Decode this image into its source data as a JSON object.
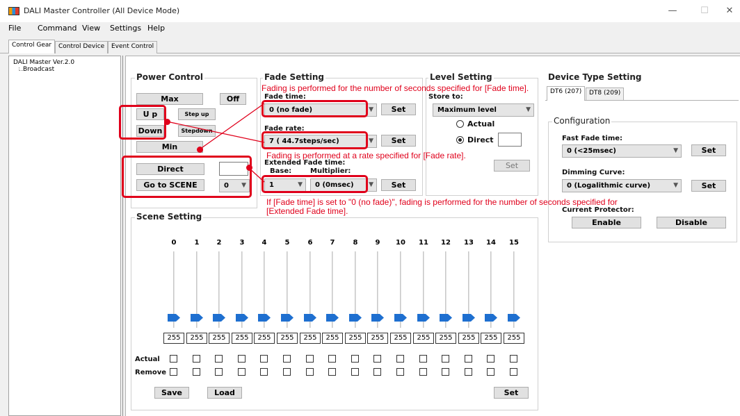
{
  "window": {
    "title": "DALI Master Controller (All Device Mode)",
    "minimize": "—",
    "maximize": "☐",
    "close": "✕"
  },
  "menu": [
    "File",
    "Command",
    "View",
    "Settings",
    "Help"
  ],
  "tabs": [
    "Control Gear",
    "Control Device",
    "Event Control"
  ],
  "tree": {
    "root": "DALI Master Ver.2.0",
    "child": "Broadcast"
  },
  "power_control": {
    "title": "Power Control",
    "max": "Max",
    "off": "Off",
    "up": "U p",
    "step_up": "Step up",
    "down": "Down",
    "step_down": "Stepdown",
    "min": "Min",
    "direct": "Direct",
    "direct_value": "",
    "go_to_scene": "Go to SCENE",
    "scene_value": "0"
  },
  "fade_setting": {
    "title": "Fade Setting",
    "fade_time_label": "Fade time:",
    "fade_time_value": "0 (no fade)",
    "fade_rate_label": "Fade rate:",
    "fade_rate_value": "7 ( 44.7steps/sec)",
    "ext_label": "Extended Fade time:",
    "base_label": "Base:",
    "multiplier_label": "Multiplier:",
    "base_value": "1",
    "multiplier_value": "0 (0msec)",
    "set": "Set"
  },
  "level_setting": {
    "title": "Level Setting",
    "store_label": "Store to:",
    "store_value": "Maximum level",
    "actual": "Actual",
    "direct": "Direct",
    "direct_value": "",
    "set": "Set"
  },
  "device_type": {
    "title": "Device Type Setting",
    "tab_dt6": "DT6 (207)",
    "tab_dt8": "DT8 (209)",
    "configuration": "Configuration",
    "fast_fade_label": "Fast Fade time:",
    "fast_fade_value": "0 (<25msec)",
    "dimming_label": "Dimming Curve:",
    "dimming_value": "0 (Logalithmic curve)",
    "protector_label": "Current Protector:",
    "enable": "Enable",
    "disable": "Disable",
    "set": "Set"
  },
  "scene_setting": {
    "title": "Scene Setting",
    "scenes": [
      "0",
      "1",
      "2",
      "3",
      "4",
      "5",
      "6",
      "7",
      "8",
      "9",
      "10",
      "11",
      "12",
      "13",
      "14",
      "15"
    ],
    "levels": [
      "255",
      "255",
      "255",
      "255",
      "255",
      "255",
      "255",
      "255",
      "255",
      "255",
      "255",
      "255",
      "255",
      "255",
      "255",
      "255"
    ],
    "actual_label": "Actual",
    "remove_label": "Remove",
    "save": "Save",
    "load": "Load",
    "set": "Set"
  },
  "annotations": {
    "fade_time": "Fading is performed for the number of seconds specified for [Fade time].",
    "fade_rate": "Fading is performed at a rate specified for [Fade rate].",
    "extended_line1": "If [Fade time] is set to \"0 (no fade)\", fading is performed for the number of seconds specified for",
    "extended_line2": "[Extended Fade time]."
  },
  "colors": {
    "highlight": "#e0001b",
    "slider_thumb": "#1e6fd0"
  },
  "icons": {
    "app": "dali-app-icon",
    "combo": "chevron-down-icon"
  }
}
